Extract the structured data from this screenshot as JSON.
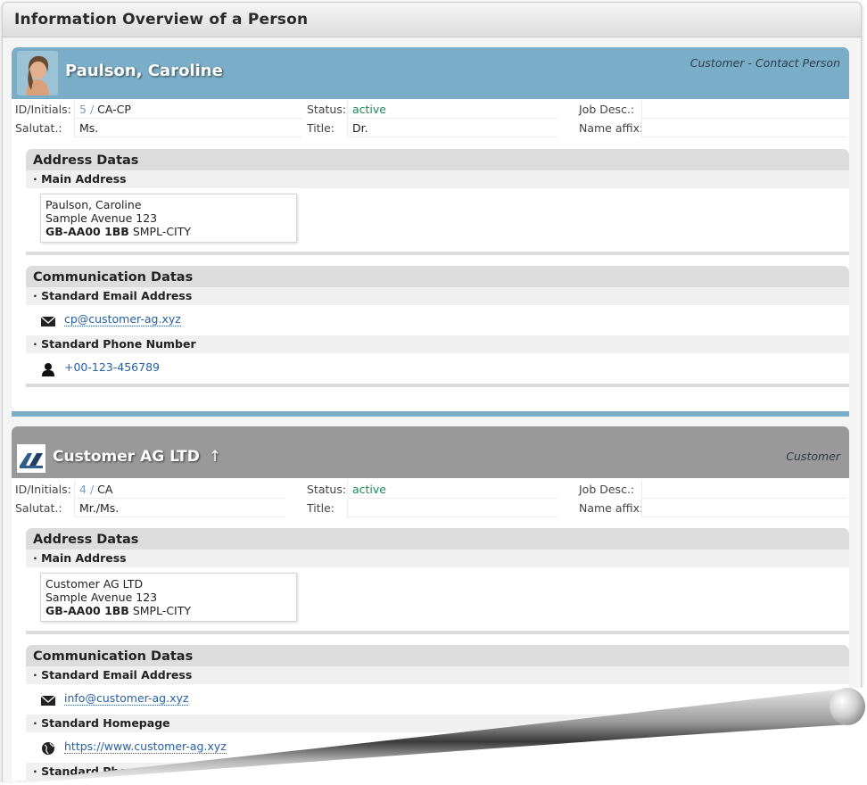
{
  "window": {
    "title": "Information Overview of a Person"
  },
  "labels": {
    "id_initials": "ID/Initials:",
    "salutation": "Salutat.:",
    "status": "Status:",
    "title": "Title:",
    "job_desc": "Job Desc.:",
    "name_affix": "Name affix:",
    "address_section": "Address Datas",
    "main_address": "· Main Address",
    "communication_section": "Communication Datas",
    "email": "· Standard Email Address",
    "phone": "· Standard Phone Number",
    "homepage": "· Standard Homepage",
    "phone_partial": "· Standard Phone Number"
  },
  "person": {
    "name": "Paulson, Caroline",
    "role": "Customer - Contact Person",
    "id": "5",
    "sep": "/",
    "initials": "CA-CP",
    "status": "active",
    "salutation": "Ms.",
    "title": "Dr.",
    "job_desc": "",
    "name_affix": "",
    "address": {
      "line1": "Paulson, Caroline",
      "line2": "Sample Avenue 123",
      "postcode": "GB-AA00 1BB",
      "city": "SMPL-CITY"
    },
    "email": "cp@customer-ag.xyz",
    "phone": "+00-123-456789",
    "header_color": "#7aaec8"
  },
  "company": {
    "name": "Customer AG LTD",
    "arrow": "↑",
    "role": "Customer",
    "id": "4",
    "sep": "/",
    "initials": "CA",
    "status": "active",
    "salutation": "Mr./Ms.",
    "title": "",
    "job_desc": "",
    "name_affix": "",
    "address": {
      "line1": "Customer AG LTD",
      "line2": "Sample Avenue 123",
      "postcode": "GB-AA00 1BB",
      "city": "SMPL-CITY"
    },
    "email": "info@customer-ag.xyz",
    "homepage": "https://www.customer-ag.xyz",
    "header_color": "#999999"
  },
  "icons": [
    "envelope-icon",
    "person-icon",
    "globe-icon",
    "up-arrow-icon"
  ],
  "colors": {
    "accent_blue": "#7aaec8",
    "link": "#2660a4",
    "status_green": "#1e8a5a",
    "section_grey": "#dcdcdc"
  }
}
